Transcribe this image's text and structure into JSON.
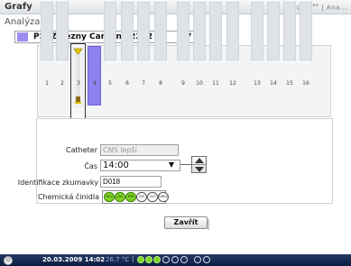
{
  "window": {
    "title": "Grafy",
    "brand": "iscus",
    "brand_sup": "flex",
    "brand_tail": "| Ana..."
  },
  "page": {
    "subtitle": "Analýza"
  },
  "patient_select": {
    "value": "P2: Zelezny Carolina 2222",
    "swatch_color": "#9a8cf0",
    "arrow": "▼"
  },
  "slots": {
    "numbers": [
      "1",
      "2",
      "3",
      "4",
      "5",
      "6",
      "7",
      "8",
      "9",
      "10",
      "11",
      "12",
      "13",
      "14",
      "15",
      "16"
    ],
    "selected": "3",
    "filled": "4"
  },
  "form": {
    "catheter_label": "Catheter",
    "catheter_value": "CNS lepší",
    "time_label": "Čas",
    "time_value": "14:00",
    "time_arrow": "▼",
    "sample_id_label": "Identifikace zkumavky",
    "sample_id_value": "D018",
    "reagents_label": "Chemická činidla",
    "reagents": [
      {
        "name": "GLU",
        "active": true
      },
      {
        "name": "LAC",
        "active": true
      },
      {
        "name": "PYR",
        "active": true
      },
      {
        "name": "GLY",
        "active": false
      },
      {
        "name": "GLT",
        "active": false
      },
      {
        "name": "UREA",
        "active": false
      }
    ]
  },
  "buttons": {
    "close": "Zavřít"
  },
  "statusbar": {
    "power_icon": "⏻",
    "datetime": "20.03.2009 14:02",
    "temp": "26.7 °C",
    "separator": "|"
  },
  "colors": {
    "accent_purple": "#9a8cf0",
    "reagent_on": "#7ed321",
    "statusbar": "#16284f"
  }
}
